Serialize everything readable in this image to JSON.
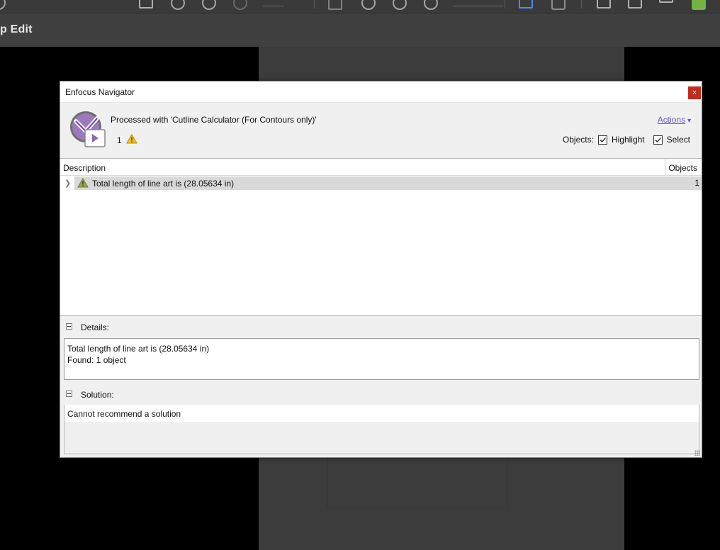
{
  "app": {
    "mode_title": "p Edit"
  },
  "dialog": {
    "title": "Enfocus Navigator",
    "close_label": "×",
    "processed_text": "Processed with 'Cutline Calculator (For Contours only)'",
    "warning_count": "1",
    "actions_label": "Actions",
    "objects_label": "Objects:",
    "highlight_label": "Highlight",
    "highlight_checked": true,
    "select_label": "Select",
    "select_checked": true,
    "list": {
      "columns": [
        "Description",
        "Objects"
      ],
      "rows": [
        {
          "description": "Total length of line art is (28.05634 in)",
          "objects": "1"
        }
      ]
    },
    "details": {
      "label": "Details:",
      "lines": [
        "Total length of line art is (28.05634 in)",
        "Found: 1 object"
      ]
    },
    "solution": {
      "label": "Solution:",
      "text": "Cannot recommend a solution"
    }
  },
  "colors": {
    "close_red": "#c42b1c",
    "link": "#6b5bd6",
    "warning_yellow": "#f5c518",
    "row_warning_green": "#9aa84a"
  }
}
